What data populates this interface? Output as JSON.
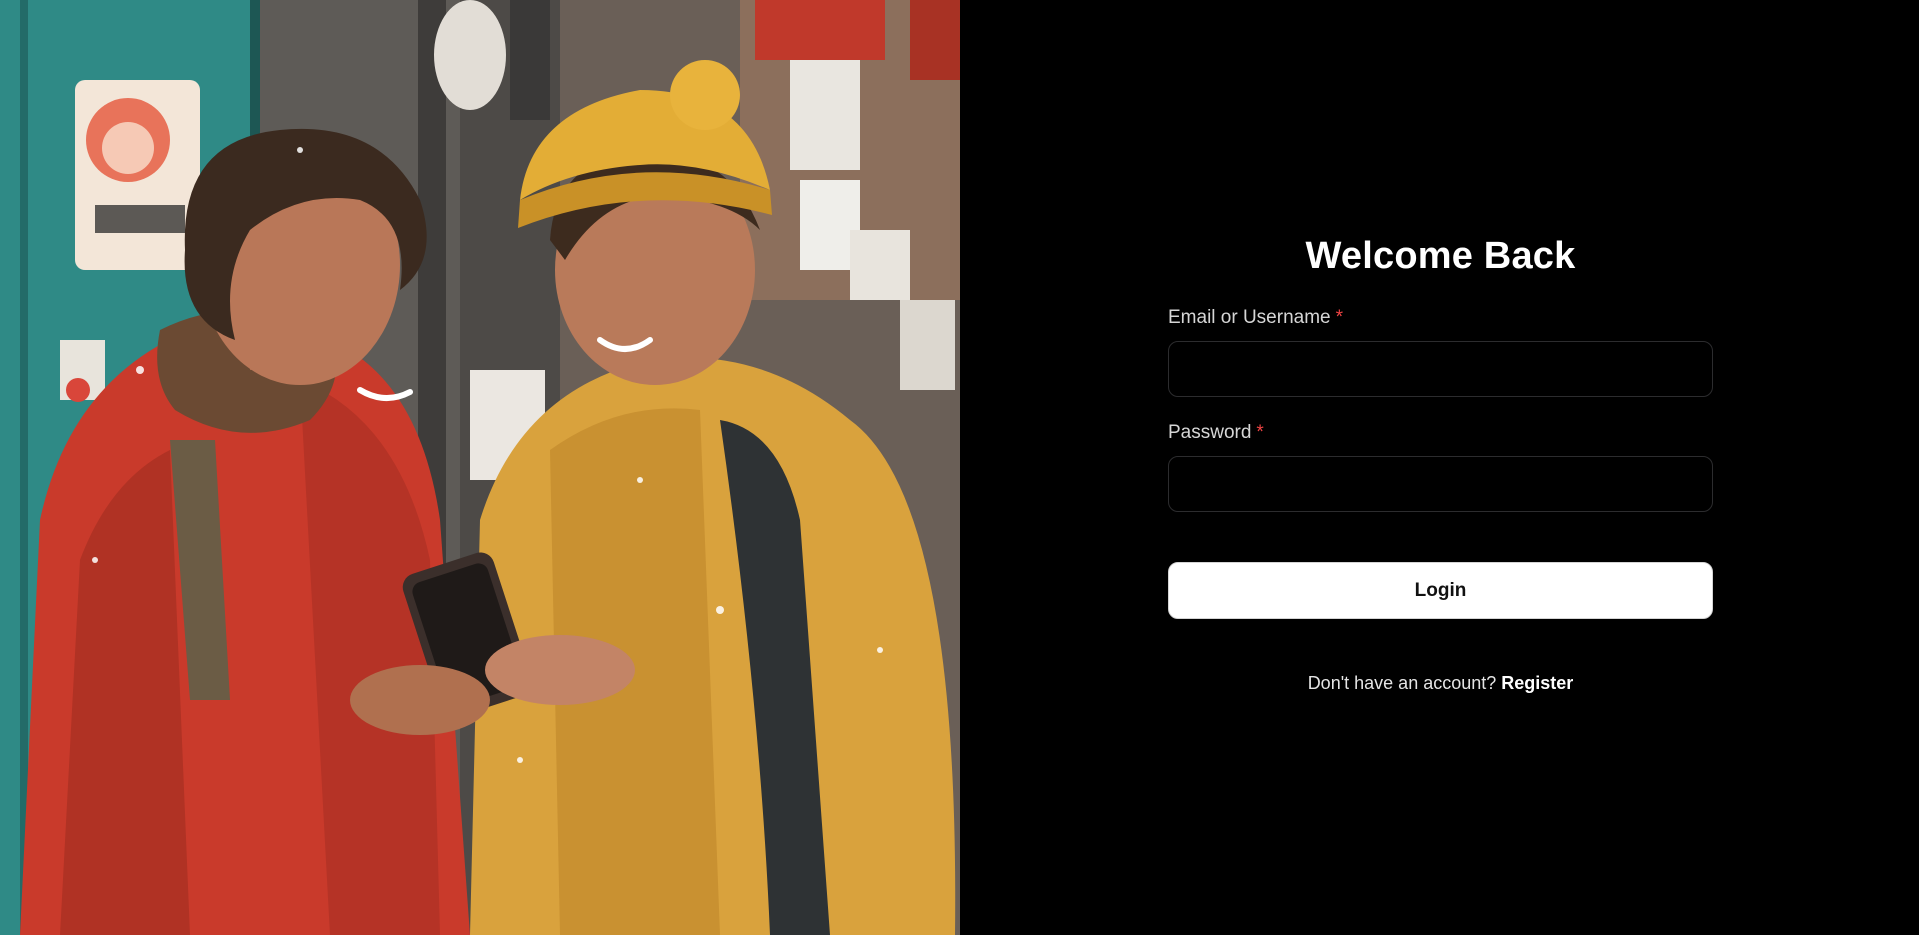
{
  "hero": {
    "image_icon": "illustration-two-people-phone"
  },
  "form": {
    "title": "Welcome Back",
    "email_label": "Email or Username",
    "email_value": "",
    "password_label": "Password",
    "password_value": "",
    "required_marker": "*",
    "login_label": "Login",
    "register_prompt": "Don't have an account?",
    "register_link": "Register"
  },
  "colors": {
    "background": "#000000",
    "required": "#ef4444",
    "button_bg": "#ffffff",
    "button_text": "#111111"
  }
}
